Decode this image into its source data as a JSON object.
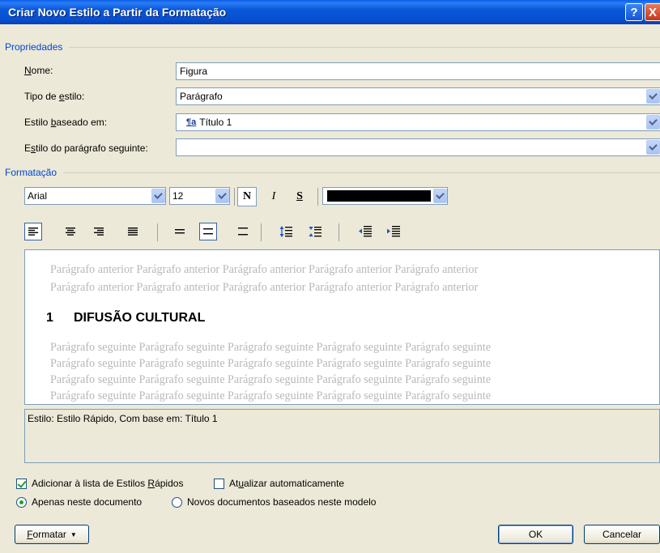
{
  "window": {
    "title": "Criar Novo Estilo a Partir da Formatação",
    "help_glyph": "?",
    "close_glyph": "X"
  },
  "properties": {
    "section_title": "Propriedades",
    "name_label": "Nome:",
    "name_value": "Figura",
    "style_type_label": "Tipo de estilo:",
    "style_type_value": "Parágrafo",
    "based_on_label": "Estilo baseado em:",
    "based_on_icon": "paragraph-style-icon",
    "based_on_value": "Título 1",
    "next_style_label": "Estilo do parágrafo seguinte:",
    "next_style_value": ""
  },
  "formatting": {
    "section_title": "Formatação",
    "font": "Arial",
    "size": "12",
    "bold_glyph": "N",
    "italic_glyph": "I",
    "underline_glyph": "S",
    "font_color": "#000000"
  },
  "preview": {
    "previous_paragraph": [
      "Parágrafo anterior Parágrafo anterior Parágrafo anterior Parágrafo anterior Parágrafo anterior",
      "Parágrafo anterior Parágrafo anterior Parágrafo anterior Parágrafo anterior Parágrafo anterior"
    ],
    "heading_number": "1",
    "heading_text": "DIFUSÃO CULTURAL",
    "following_paragraph": [
      "Parágrafo seguinte Parágrafo seguinte Parágrafo seguinte Parágrafo seguinte Parágrafo seguinte",
      "Parágrafo seguinte Parágrafo seguinte Parágrafo seguinte Parágrafo seguinte Parágrafo seguinte",
      "Parágrafo seguinte Parágrafo seguinte Parágrafo seguinte Parágrafo seguinte Parágrafo seguinte",
      "Parágrafo seguinte Parágrafo seguinte Parágrafo seguinte Parágrafo seguinte Parágrafo seguinte"
    ]
  },
  "description": "Estilo: Estilo Rápido, Com base em: Título 1",
  "options": {
    "add_quick_styles": {
      "label": "Adicionar à lista de Estilos Rápidos",
      "checked": true
    },
    "auto_update": {
      "label": "Atualizar automaticamente",
      "checked": false
    },
    "only_this_document": {
      "label": "Apenas neste documento",
      "selected": true
    },
    "new_documents": {
      "label": "Novos documentos baseados neste modelo",
      "selected": false
    }
  },
  "buttons": {
    "format": "Formatar",
    "ok": "OK",
    "cancel": "Cancelar"
  },
  "colors": {
    "section_title": "#0046d5",
    "titlebar": "#0a58d8",
    "dialog_bg": "#ece9d8",
    "preview_ghost_text": "#b8b8b8"
  }
}
